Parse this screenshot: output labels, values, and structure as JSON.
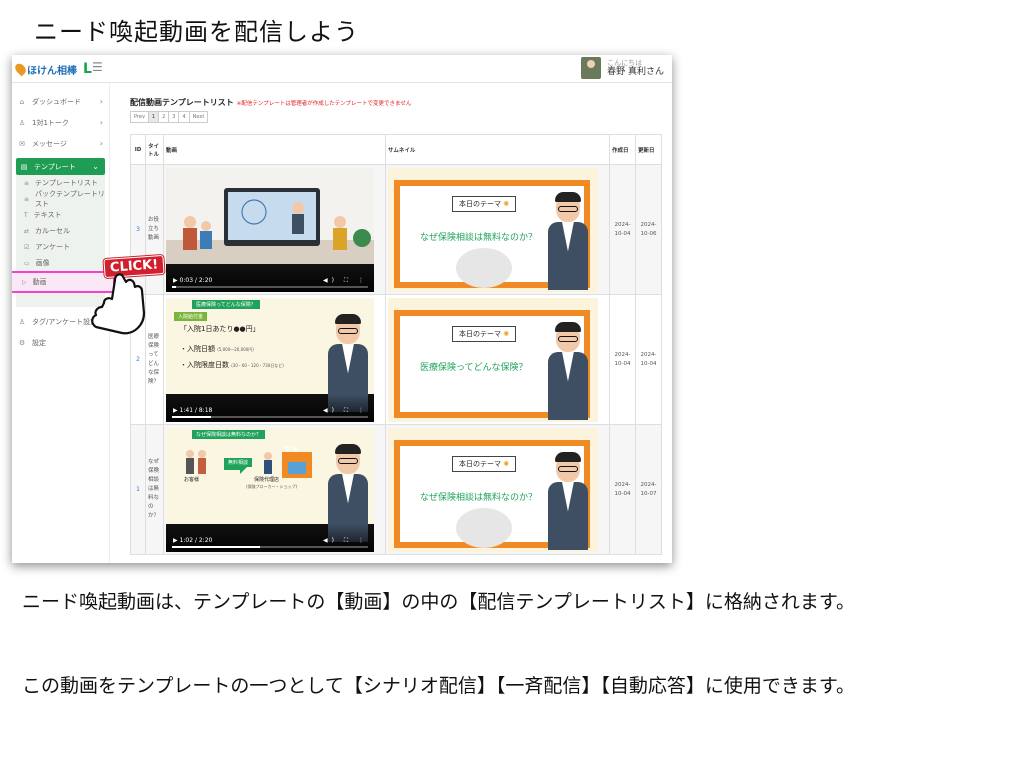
{
  "slide": {
    "title": "ニード喚起動画を配信しよう",
    "desc1": "ニード喚起動画は、テンプレートの【動画】の中の【配信テンプレートリスト】に格納されます。",
    "desc2": "この動画をテンプレートの一つとして【シナリオ配信】【一斉配信】【自動応答】に使用できます。"
  },
  "app": {
    "logo_text": "ほけん相棒",
    "logo_l": "L",
    "menu_icon": "☰",
    "user_greeting": "こんにちは",
    "user_name": "春野 真利さん",
    "colors": {
      "accent": "#1f9d55",
      "highlight": "#f542c8",
      "click_badge": "#d0202e"
    }
  },
  "sidebar": {
    "items": [
      {
        "label": "ダッシュボード",
        "icon": "home-icon",
        "glyph": "⌂",
        "chev": "›"
      },
      {
        "label": "1対1トーク",
        "icon": "user-icon",
        "glyph": "♙",
        "chev": "›"
      },
      {
        "label": "メッセージ",
        "icon": "message-icon",
        "glyph": "✉",
        "chev": "›"
      }
    ],
    "active": {
      "label": "テンプレート",
      "icon": "template-icon",
      "glyph": "▤",
      "chev": "⌄"
    },
    "subs": [
      {
        "label": "テンプレートリスト",
        "glyph": "≡"
      },
      {
        "label": "パックテンプレートリスト",
        "glyph": "≡"
      },
      {
        "label": "テキスト",
        "glyph": "T"
      },
      {
        "label": "カルーセル",
        "glyph": "⇄"
      },
      {
        "label": "アンケート",
        "glyph": "☑"
      },
      {
        "label": "画像",
        "glyph": "▭"
      }
    ],
    "highlighted": {
      "label": "動画",
      "glyph": "▷"
    },
    "after": [
      {
        "label": "タグ/アンケート設定",
        "icon": "tag-icon",
        "glyph": "♙"
      },
      {
        "label": "設定",
        "icon": "gear-icon",
        "glyph": "⚙"
      }
    ],
    "click_label": "CLICK!"
  },
  "main": {
    "heading": "配信動画テンプレートリスト",
    "heading_note": "※配信テンプレートは管理者が作成したテンプレートで変更できません",
    "pager": [
      "Prev",
      "1",
      "2",
      "3",
      "4",
      "Next"
    ],
    "columns": {
      "id": "ID",
      "title": "タイトル",
      "video": "動画",
      "thumb": "サムネイル",
      "created": "作成日",
      "updated": "更新日"
    },
    "rows": [
      {
        "id": "3",
        "title": "お役立ち動画",
        "created": "2024-10-04",
        "updated": "2024-10-06",
        "video_time": "0:03 / 2:20",
        "progress": 0.02,
        "thumb_theme": "本日のテーマ",
        "thumb_question": "なぜ保険相談は無料なのか？"
      },
      {
        "id": "2",
        "title": "医療保険ってどんな保険？",
        "created": "2024-10-04",
        "updated": "2024-10-04",
        "video_time": "1:41 / 8:18",
        "progress": 0.2,
        "video_banner": "医療保険ってどんな保険？",
        "video_tag": "入院給付金",
        "video_line1": "「入院1日あたり●●円」",
        "video_line2": "・入院日額",
        "video_line2_small": "(5,000〜20,000円)",
        "video_line3": "・入院限度日数",
        "video_line3_small": "(30・60・120・730日など)",
        "thumb_theme": "本日のテーマ",
        "thumb_question": "医療保険ってどんな保険？"
      },
      {
        "id": "1",
        "title": "なぜ保険相談は無料なのか？",
        "created": "2024-10-04",
        "updated": "2024-10-07",
        "video_time": "1:02 / 2:20",
        "progress": 0.45,
        "video_banner": "なぜ保険相談は無料なのか？",
        "video_label_free": "無料相談",
        "video_label_ins": "保 険",
        "video_label_client": "お客様",
        "video_label_agent": "保険代理店",
        "video_label_agent_small": "(保険ブローカー・ショップ)",
        "thumb_theme": "本日のテーマ",
        "thumb_question": "なぜ保険相談は無料なのか？"
      }
    ],
    "player_icons": "◀) ⛶ ⋮",
    "play_icon": "▶"
  }
}
